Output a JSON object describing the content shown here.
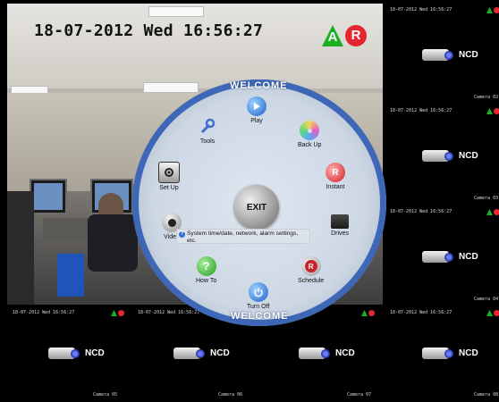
{
  "main_view": {
    "datetime": "18-07-2012 Wed 16:56:27",
    "badge_a": "A",
    "badge_r": "R"
  },
  "tiles": [
    {
      "datetime": "18-07-2012 Wed 16:56:27",
      "label": "NCD",
      "camera": "Camera 02"
    },
    {
      "datetime": "18-07-2012 Wed 16:56:27",
      "label": "NCD",
      "camera": "Camera 03"
    },
    {
      "datetime": "18-07-2012 Wed 16:56:27",
      "label": "NCD",
      "camera": "Camera 04"
    },
    {
      "datetime": "18-07-2012 Wed 16:56:27",
      "label": "NCD",
      "camera": "Camera 05"
    },
    {
      "datetime": "18-07-2012 Wed 16:56:27",
      "label": "NCD",
      "camera": "Camera 06"
    },
    {
      "datetime": "",
      "label": "NCD",
      "camera": "Camera 07"
    },
    {
      "datetime": "18-07-2012 Wed 16:56:27",
      "label": "NCD",
      "camera": "Camera 08"
    }
  ],
  "menu": {
    "welcome_top": "WELCOME",
    "welcome_bottom": "WELCOME",
    "exit": "EXIT",
    "tooltip": "System time/date, network, alarm settings, etc.",
    "items": {
      "play": "Play",
      "backup": "Back Up",
      "instant": "Instant",
      "drives": "Drives",
      "schedule": "Schedule",
      "turnoff": "Turn Off",
      "howto": "How To",
      "video": "Video",
      "setup": "Set Up",
      "tools": "Tools"
    }
  },
  "colors": {
    "ring_blue": "#3e68b7",
    "badge_green": "#1bb024",
    "badge_red": "#e4262f"
  }
}
